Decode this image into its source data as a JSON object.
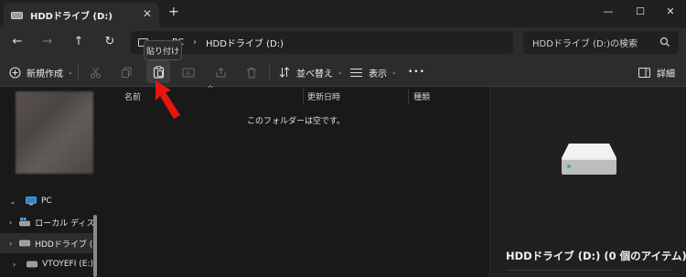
{
  "window": {
    "tab_title": "HDDドライブ (D:)",
    "tab_close": "✕",
    "new_tab": "+",
    "minimize": "—",
    "maximize": "☐",
    "close": "✕"
  },
  "nav": {
    "back": "←",
    "forward": "→",
    "up": "↑",
    "refresh": "↻",
    "breadcrumb": [
      "PC",
      "HDDドライブ (D:)"
    ],
    "breadcrumb_sep": "›",
    "search_placeholder": "HDDドライブ (D:)の検索"
  },
  "commands": {
    "new_label": "新規作成",
    "sort_label": "並べ替え",
    "view_label": "表示",
    "more": "•••",
    "details_label": "詳細",
    "tooltip": "貼り付け"
  },
  "columns": {
    "name": "名前",
    "modified": "更新日時",
    "type": "種類",
    "sort_caret": "^"
  },
  "main": {
    "empty_message": "このフォルダーは空です。"
  },
  "sidebar": {
    "items": [
      {
        "label": "PC",
        "expanded": true,
        "icon": "monitor-icon"
      },
      {
        "label": "ローカル ディスク",
        "icon": "windows-disk-icon"
      },
      {
        "label": "HDDドライブ (D:",
        "icon": "drive-icon",
        "selected": true
      },
      {
        "label": "VTOYEFI (E:)",
        "icon": "drive-icon"
      }
    ]
  },
  "details": {
    "title": "HDDドライブ (D:) (0 個のアイテム)"
  },
  "colors": {
    "background": "#191919",
    "chrome": "#2c2c2c",
    "pointer_arrow": "#e8160c",
    "accent": "#60cdff"
  }
}
